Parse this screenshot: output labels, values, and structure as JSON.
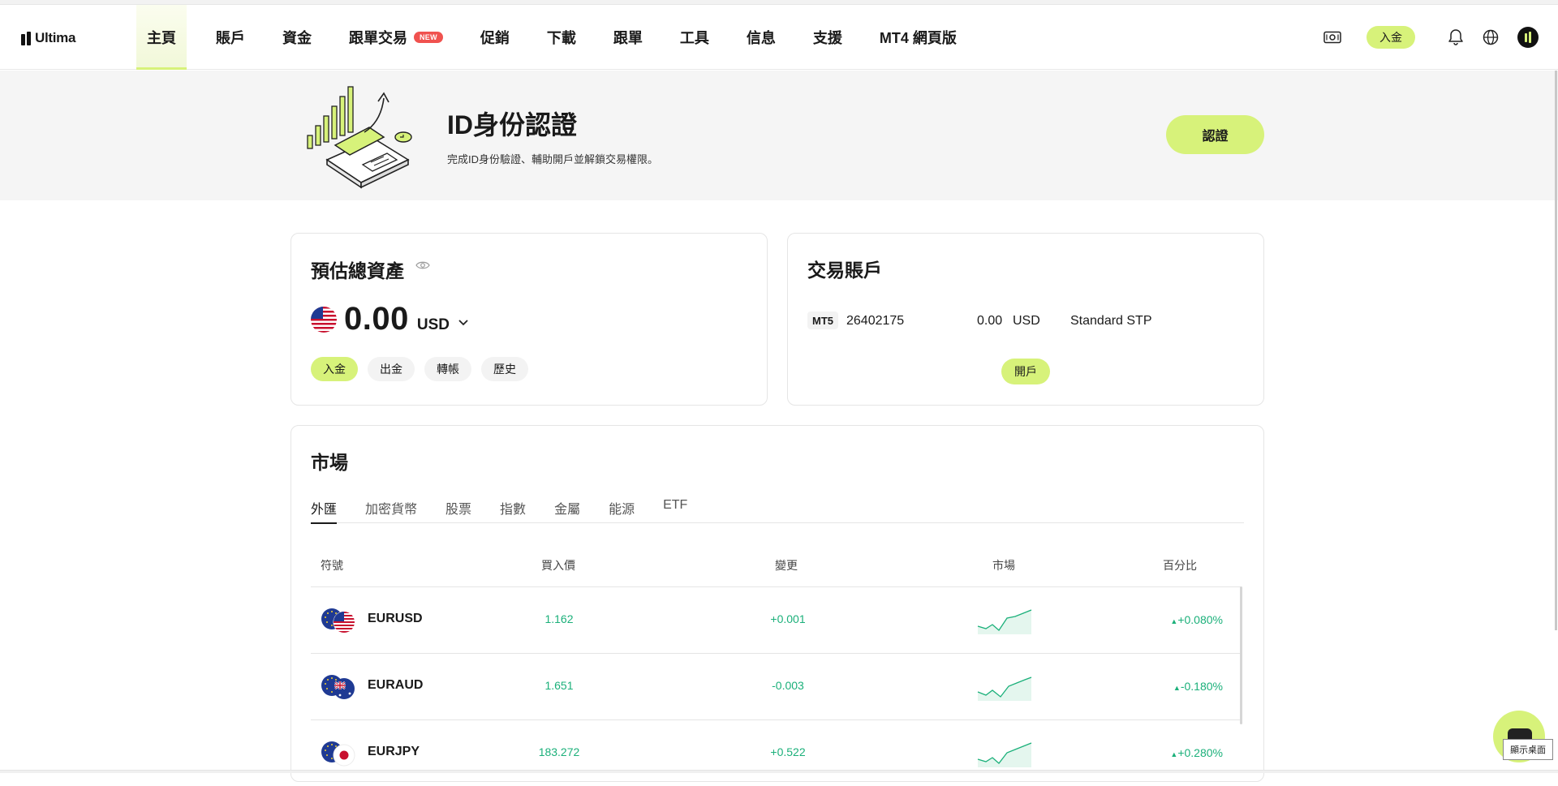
{
  "brand": {
    "name": "Ultima"
  },
  "nav": {
    "items": [
      {
        "label": "主頁",
        "active": true
      },
      {
        "label": "賬戶"
      },
      {
        "label": "資金"
      },
      {
        "label": "跟單交易",
        "badge": "NEW"
      },
      {
        "label": "促銷"
      },
      {
        "label": "下載"
      },
      {
        "label": "跟單"
      },
      {
        "label": "工具"
      },
      {
        "label": "信息"
      },
      {
        "label": "支援"
      },
      {
        "label": "MT4 網頁版"
      }
    ],
    "deposit_label": "入金",
    "icons": [
      "cash-icon",
      "bell-icon",
      "globe-icon",
      "avatar"
    ]
  },
  "banner": {
    "title": "ID身份認證",
    "subtitle": "完成ID身份驗證、輔助開戶並解鎖交易權限。",
    "button": "認證"
  },
  "assets": {
    "title": "預估總資產",
    "amount": "0.00",
    "currency": "USD",
    "actions": [
      "入金",
      "出金",
      "轉帳",
      "歷史"
    ]
  },
  "trading": {
    "title": "交易賬戶",
    "platform": "MT5",
    "account_no": "26402175",
    "balance": "0.00",
    "currency": "USD",
    "type": "Standard STP",
    "open_button": "開戶"
  },
  "market": {
    "title": "市場",
    "tabs": [
      "外匯",
      "加密貨幣",
      "股票",
      "指數",
      "金屬",
      "能源",
      "ETF"
    ],
    "active_tab": "外匯",
    "columns": [
      "符號",
      "買入價",
      "變更",
      "市場",
      "百分比"
    ],
    "rows": [
      {
        "symbol": "EURUSD",
        "bid": "1.162",
        "change": "+0.001",
        "percent": "+0.080%"
      },
      {
        "symbol": "EURAUD",
        "bid": "1.651",
        "change": "-0.003",
        "percent": "-0.180%"
      },
      {
        "symbol": "EURJPY",
        "bid": "183.272",
        "change": "+0.522",
        "percent": "+0.280%"
      }
    ]
  },
  "tooltip": "顯示桌面",
  "colors": {
    "accent": "#d7f27a",
    "positive": "#1bb07a",
    "badge": "#f0524f"
  }
}
